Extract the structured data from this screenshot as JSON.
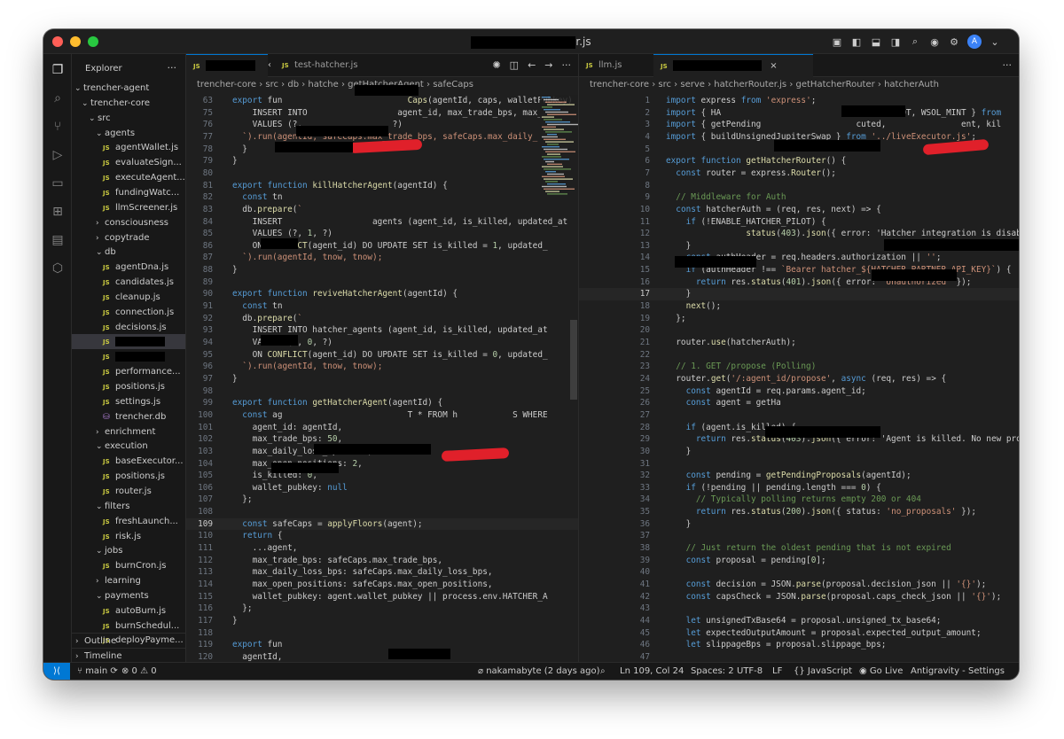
{
  "window": {
    "title_suffix": "r.js"
  },
  "activity_icons": [
    "files-icon",
    "search-icon",
    "source-control-icon",
    "run-debug-icon",
    "remote-explorer-icon",
    "extensions-icon",
    "notebook-icon",
    "box-icon"
  ],
  "sidebar": {
    "title": "Explorer",
    "more": "···",
    "tree": [
      {
        "label": "trencher-agent",
        "kind": "folder-open",
        "indent": 0
      },
      {
        "label": "trencher-core",
        "kind": "folder-open",
        "indent": 1
      },
      {
        "label": "src",
        "kind": "folder-open",
        "indent": 2
      },
      {
        "label": "agents",
        "kind": "folder-open",
        "indent": 3
      },
      {
        "label": "agentWallet.js",
        "kind": "js",
        "indent": 4
      },
      {
        "label": "evaluateSign...",
        "kind": "js",
        "indent": 4
      },
      {
        "label": "executeAgent...",
        "kind": "js",
        "indent": 4
      },
      {
        "label": "fundingWatc...",
        "kind": "js",
        "indent": 4
      },
      {
        "label": "llmScreener.js",
        "kind": "js",
        "indent": 4
      },
      {
        "label": "consciousness",
        "kind": "folder",
        "indent": 3
      },
      {
        "label": "copytrade",
        "kind": "folder",
        "indent": 3
      },
      {
        "label": "db",
        "kind": "folder-open",
        "indent": 3
      },
      {
        "label": "agentDna.js",
        "kind": "js",
        "indent": 4
      },
      {
        "label": "candidates.js",
        "kind": "js",
        "indent": 4
      },
      {
        "label": "cleanup.js",
        "kind": "js",
        "indent": 4
      },
      {
        "label": "connection.js",
        "kind": "js",
        "indent": 4
      },
      {
        "label": "decisions.js",
        "kind": "js",
        "indent": 4
      },
      {
        "label": "",
        "kind": "js",
        "indent": 4,
        "selected": true
      },
      {
        "label": "",
        "kind": "js",
        "indent": 4
      },
      {
        "label": "performance...",
        "kind": "js",
        "indent": 4
      },
      {
        "label": "positions.js",
        "kind": "js",
        "indent": 4
      },
      {
        "label": "settings.js",
        "kind": "js",
        "indent": 4
      },
      {
        "label": "trencher.db",
        "kind": "db",
        "indent": 4
      },
      {
        "label": "enrichment",
        "kind": "folder",
        "indent": 3
      },
      {
        "label": "execution",
        "kind": "folder-open",
        "indent": 3
      },
      {
        "label": "baseExecutor...",
        "kind": "js",
        "indent": 4
      },
      {
        "label": "positions.js",
        "kind": "js",
        "indent": 4
      },
      {
        "label": "router.js",
        "kind": "js",
        "indent": 4
      },
      {
        "label": "filters",
        "kind": "folder-open",
        "indent": 3
      },
      {
        "label": "freshLaunch...",
        "kind": "js",
        "indent": 4
      },
      {
        "label": "risk.js",
        "kind": "js",
        "indent": 4
      },
      {
        "label": "jobs",
        "kind": "folder-open",
        "indent": 3
      },
      {
        "label": "burnCron.js",
        "kind": "js",
        "indent": 4
      },
      {
        "label": "learning",
        "kind": "folder",
        "indent": 3
      },
      {
        "label": "payments",
        "kind": "folder-open",
        "indent": 3
      },
      {
        "label": "autoBurn.js",
        "kind": "js",
        "indent": 4
      },
      {
        "label": "burnSchedul...",
        "kind": "js",
        "indent": 4
      },
      {
        "label": "deployPayme...",
        "kind": "js",
        "indent": 4
      }
    ],
    "outline": "Outline",
    "timeline": "Timeline"
  },
  "left_editor": {
    "tabs": [
      {
        "label": "",
        "active": true,
        "icon": "JS"
      },
      {
        "label": "test-hatcher.js",
        "active": false,
        "icon": "JS"
      }
    ],
    "breadcrumb": [
      "trencher-core",
      "src",
      "db",
      "hatche",
      "getHatcherAgent",
      "safeCaps"
    ],
    "lines": [
      {
        "n": "63",
        "t": "export fun                         Caps(agentId, caps, walletPubkey) {"
      },
      {
        "n": "75",
        "t": "    INSERT INTO                  agent_id, max_trade_bps, max_"
      },
      {
        "n": "76",
        "t": "    VALUES (?,                  ?)"
      },
      {
        "n": "77",
        "t": "  `).run(agentId, safeCaps.max_trade_bps, safeCaps.max_daily_"
      },
      {
        "n": "78",
        "t": "  }"
      },
      {
        "n": "79",
        "t": "}"
      },
      {
        "n": "80",
        "t": ""
      },
      {
        "n": "81",
        "t": "export function killHatcherAgent(agentId) {"
      },
      {
        "n": "82",
        "t": "  const tn"
      },
      {
        "n": "83",
        "t": "  db.prepare(`"
      },
      {
        "n": "84",
        "t": "    INSERT                  agents (agent_id, is_killed, updated_at"
      },
      {
        "n": "85",
        "t": "    VALUES (?, 1, ?)"
      },
      {
        "n": "86",
        "t": "    ON CONFLICT(agent_id) DO UPDATE SET is_killed = 1, updated_"
      },
      {
        "n": "87",
        "t": "  `).run(agentId, tnow, tnow);"
      },
      {
        "n": "88",
        "t": "}"
      },
      {
        "n": "89",
        "t": ""
      },
      {
        "n": "90",
        "t": "export function reviveHatcherAgent(agentId) {"
      },
      {
        "n": "91",
        "t": "  const tn"
      },
      {
        "n": "92",
        "t": "  db.prepare(`"
      },
      {
        "n": "93",
        "t": "    INSERT INTO hatcher_agents (agent_id, is_killed, updated_at"
      },
      {
        "n": "94",
        "t": "    VALUES (?, 0, ?)"
      },
      {
        "n": "95",
        "t": "    ON CONFLICT(agent_id) DO UPDATE SET is_killed = 0, updated_"
      },
      {
        "n": "96",
        "t": "  `).run(agentId, tnow, tnow);"
      },
      {
        "n": "97",
        "t": "}"
      },
      {
        "n": "98",
        "t": ""
      },
      {
        "n": "99",
        "t": "export function getHatcherAgent(agentId) {"
      },
      {
        "n": "100",
        "t": "  const ag                         T * FROM h           S WHERE"
      },
      {
        "n": "101",
        "t": "    agent_id: agentId,"
      },
      {
        "n": "102",
        "t": "    max_trade_bps: 50,"
      },
      {
        "n": "103",
        "t": "    max_daily_loss_bps: 300,"
      },
      {
        "n": "104",
        "t": "    max_open_positions: 2,"
      },
      {
        "n": "105",
        "t": "    is_killed: 0,"
      },
      {
        "n": "106",
        "t": "    wallet_pubkey: null"
      },
      {
        "n": "107",
        "t": "  };"
      },
      {
        "n": "108",
        "t": ""
      },
      {
        "n": "109",
        "t": "  const safeCaps = applyFloors(agent);"
      },
      {
        "n": "110",
        "t": "  return {"
      },
      {
        "n": "111",
        "t": "    ...agent,"
      },
      {
        "n": "112",
        "t": "    max_trade_bps: safeCaps.max_trade_bps,"
      },
      {
        "n": "113",
        "t": "    max_daily_loss_bps: safeCaps.max_daily_loss_bps,"
      },
      {
        "n": "114",
        "t": "    max_open_positions: safeCaps.max_open_positions,"
      },
      {
        "n": "115",
        "t": "    wallet_pubkey: agent.wallet_pubkey || process.env.HATCHER_A"
      },
      {
        "n": "116",
        "t": "  };"
      },
      {
        "n": "117",
        "t": "}"
      },
      {
        "n": "118",
        "t": ""
      },
      {
        "n": "119",
        "t": "export fun"
      },
      {
        "n": "120",
        "t": "  agentId,"
      }
    ]
  },
  "right_editor": {
    "tabs": [
      {
        "label": "llm.js",
        "active": false,
        "icon": "JS"
      },
      {
        "label": "",
        "active": true,
        "icon": "JS"
      }
    ],
    "breadcrumb": [
      "trencher-core",
      "src",
      "serve",
      "hatcherRouter.js",
      "getHatcherRouter",
      "hatcherAuth"
    ],
    "lines": [
      {
        "n": "1",
        "t": "import express from 'express';"
      },
      {
        "n": "2",
        "t": "import { HA                                 PILOT, WSOL_MINT } from"
      },
      {
        "n": "3",
        "t": "import { getPending                   cuted,               ent, kil"
      },
      {
        "n": "4",
        "t": "import { buildUnsignedJupiterSwap } from '../liveExecutor.js';"
      },
      {
        "n": "5",
        "t": ""
      },
      {
        "n": "6",
        "t": "export function getHatcherRouter() {"
      },
      {
        "n": "7",
        "t": "  const router = express.Router();"
      },
      {
        "n": "8",
        "t": ""
      },
      {
        "n": "9",
        "t": "  // Middleware for Auth"
      },
      {
        "n": "10",
        "t": "  const hatcherAuth = (req, res, next) => {"
      },
      {
        "n": "11",
        "t": "    if (!ENABLE_HATCHER_PILOT) {"
      },
      {
        "n": "12",
        "t": "                status(403).json({ error: 'Hatcher integration is disab"
      },
      {
        "n": "13",
        "t": "    }"
      },
      {
        "n": "14",
        "t": "    const authHeader = req.headers.authorization || '';"
      },
      {
        "n": "15",
        "t": "    if (authHeader !== `Bearer hatcher_${HATCHER_PARTNER_API_KEY}`) {"
      },
      {
        "n": "16",
        "t": "      return res.status(401).json({ error: 'Unauthorized' });"
      },
      {
        "n": "17",
        "t": "    }"
      },
      {
        "n": "18",
        "t": "    next();"
      },
      {
        "n": "19",
        "t": "  };"
      },
      {
        "n": "20",
        "t": ""
      },
      {
        "n": "21",
        "t": "  router.use(hatcherAuth);"
      },
      {
        "n": "22",
        "t": ""
      },
      {
        "n": "23",
        "t": "  // 1. GET /propose (Polling)"
      },
      {
        "n": "24",
        "t": "  router.get('/:agent_id/propose', async (req, res) => {"
      },
      {
        "n": "25",
        "t": "    const agentId = req.params.agent_id;"
      },
      {
        "n": "26",
        "t": "    const agent = getHa"
      },
      {
        "n": "27",
        "t": ""
      },
      {
        "n": "28",
        "t": "    if (agent.is_killed) {"
      },
      {
        "n": "29",
        "t": "      return res.status(403).json({ error: 'Agent is killed. No new prop"
      },
      {
        "n": "30",
        "t": "    }"
      },
      {
        "n": "31",
        "t": ""
      },
      {
        "n": "32",
        "t": "    const pending = getPendingProposals(agentId);"
      },
      {
        "n": "33",
        "t": "    if (!pending || pending.length === 0) {"
      },
      {
        "n": "34",
        "t": "      // Typically polling returns empty 200 or 404"
      },
      {
        "n": "35",
        "t": "      return res.status(200).json({ status: 'no_proposals' });"
      },
      {
        "n": "36",
        "t": "    }"
      },
      {
        "n": "37",
        "t": ""
      },
      {
        "n": "38",
        "t": "    // Just return the oldest pending that is not expired"
      },
      {
        "n": "39",
        "t": "    const proposal = pending[0];"
      },
      {
        "n": "40",
        "t": ""
      },
      {
        "n": "41",
        "t": "    const decision = JSON.parse(proposal.decision_json || '{}');"
      },
      {
        "n": "42",
        "t": "    const capsCheck = JSON.parse(proposal.caps_check_json || '{}');"
      },
      {
        "n": "43",
        "t": ""
      },
      {
        "n": "44",
        "t": "    let unsignedTxBase64 = proposal.unsigned_tx_base64;"
      },
      {
        "n": "45",
        "t": "    let expectedOutputAmount = proposal.expected_output_amount;"
      },
      {
        "n": "46",
        "t": "    let slippageBps = proposal.slippage_bps;"
      },
      {
        "n": "47",
        "t": ""
      }
    ]
  },
  "statusbar": {
    "branch": "main",
    "problems": "⊗ 0 ⚠ 0",
    "blame": "nakamabyte (2 days ago)",
    "position": "Ln 109, Col 24",
    "spaces": "Spaces: 2",
    "encoding": "UTF-8",
    "eol": "LF",
    "language": "JavaScript",
    "golive": "Go Live",
    "settings": "Antigravity - Settings"
  },
  "colors": {
    "accent": "#0078d4",
    "editor_bg": "#1f1f1f",
    "sidebar_bg": "#181818"
  }
}
